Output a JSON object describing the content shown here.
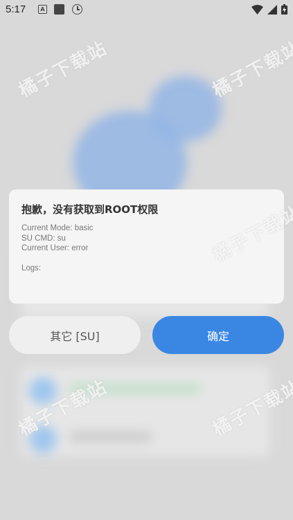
{
  "status_bar": {
    "time": "5:17",
    "a_icon_letter": "A"
  },
  "dialog": {
    "title": "抱歉，没有获取到ROOT权限",
    "lines": [
      "Current Mode: basic",
      "SU CMD: su",
      "Current User: error"
    ],
    "logs_label": "Logs:"
  },
  "buttons": {
    "other": "其它 [SU]",
    "ok": "确定"
  },
  "watermark": "橘子下载站",
  "colors": {
    "primary": "#3a87e3",
    "dialog_bg": "#f5f5f5"
  }
}
